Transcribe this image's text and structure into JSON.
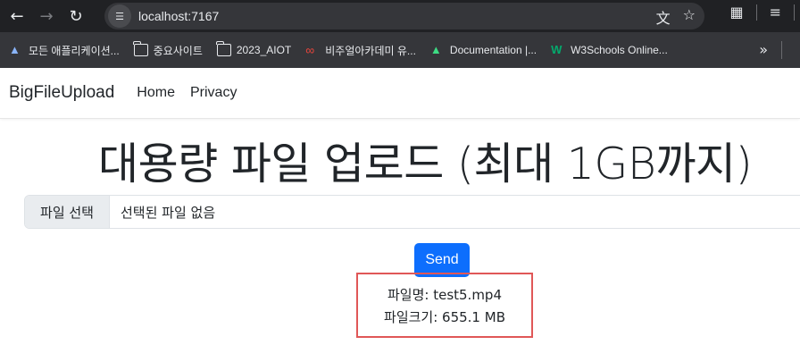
{
  "browser": {
    "url": "localhost:7167",
    "bookmarks": [
      {
        "label": "모든 애플리케이션...",
        "icon": "apps-icon"
      },
      {
        "label": "중요사이트",
        "icon": "folder-icon"
      },
      {
        "label": "2023_AIOT",
        "icon": "folder-icon"
      },
      {
        "label": "비주얼아카데미 유...",
        "icon": "infinity-icon"
      },
      {
        "label": "Documentation |...",
        "icon": "android-icon"
      },
      {
        "label": "W3Schools Online...",
        "icon": "w3schools-icon"
      }
    ],
    "more": "»"
  },
  "navbar": {
    "brand": "BigFileUpload",
    "links": [
      "Home",
      "Privacy"
    ]
  },
  "main": {
    "title": "대용량 파일 업로드 (최대 1GB까지)",
    "file_button": "파일 선택",
    "file_status": "선택된 파일 없음",
    "send": "Send",
    "result": {
      "filename_line": "파일명: test5.mp4",
      "filesize_line": "파일크기: 655.1 MB"
    }
  }
}
